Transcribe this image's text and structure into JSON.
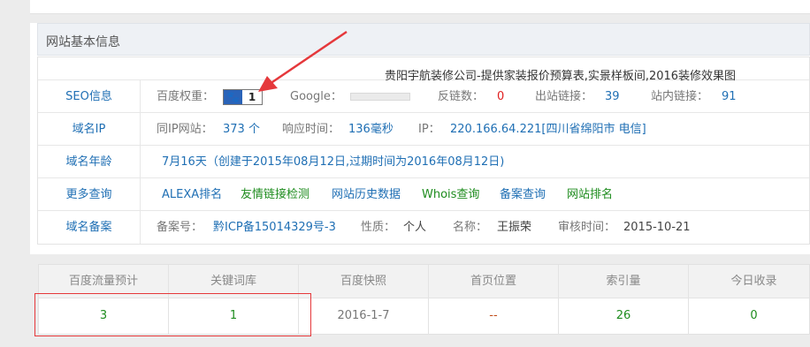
{
  "panel": {
    "title": "网站基本信息",
    "site_title": "贵阳宇航装修公司-提供家装报价预算表,实景样板间,2016装修效果图"
  },
  "seo": {
    "label": "SEO信息",
    "baidu_weight_label": "百度权重：",
    "baidu_weight_value": "1",
    "google_label": "Google：",
    "backlinks_label": "反链数：",
    "backlinks_value": "0",
    "outlinks_label": "出站链接：",
    "outlinks_value": "39",
    "inlinks_label": "站内链接：",
    "inlinks_value": "91"
  },
  "domain_ip": {
    "label": "域名IP",
    "same_ip_label": "同IP网站：",
    "same_ip_value": "373 个",
    "response_label": "响应时间：",
    "response_value": "136毫秒",
    "ip_label": "IP：",
    "ip_value": "220.166.64.221[四川省绵阳市 电信]"
  },
  "domain_age": {
    "label": "域名年龄",
    "value": "7月16天（创建于2015年08月12日,过期时间为2016年08月12日)"
  },
  "more": {
    "label": "更多查询",
    "links": [
      "ALEXA排名",
      "友情链接检测",
      "网站历史数据",
      "Whois查询",
      "备案查询",
      "网站排名"
    ]
  },
  "icp": {
    "label": "域名备案",
    "number_label": "备案号：",
    "number_value": "黔ICP备15014329号-3",
    "nature_label": "性质：",
    "nature_value": "个人",
    "name_label": "名称：",
    "name_value": "王振荣",
    "audit_label": "审核时间：",
    "audit_value": "2015-10-21"
  },
  "stats": {
    "headers": [
      "百度流量预计",
      "关键词库",
      "百度快照",
      "首页位置",
      "索引量",
      "今日收录"
    ],
    "values": [
      "3",
      "1",
      "2016-1-7",
      "--",
      "26",
      "0"
    ]
  },
  "colors": {
    "link_blue": "#1f6fb4",
    "green": "#1e8c1e",
    "red": "#e02020",
    "annotation_red": "#e5383b",
    "baidu_blue": "#2a63b8"
  }
}
